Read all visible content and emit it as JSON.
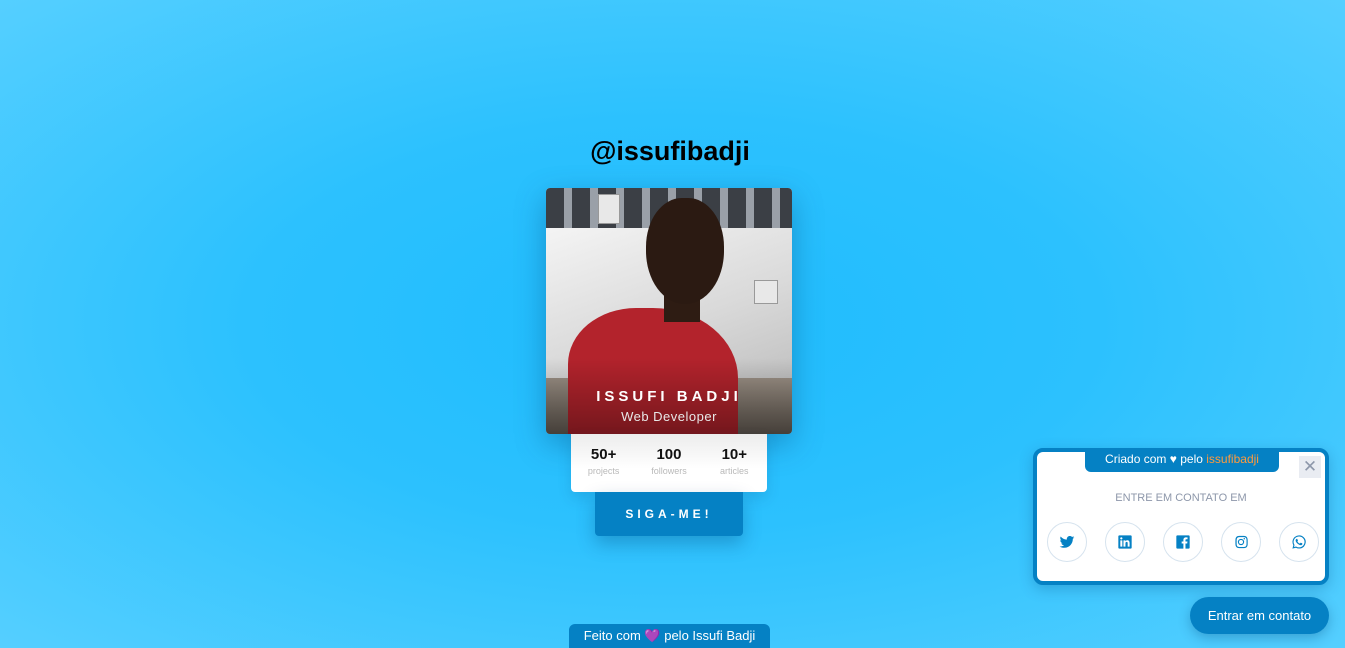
{
  "profile": {
    "handle": "@issufibadji",
    "name": "ISSUFI BADJI",
    "role": "Web Developer",
    "stats": [
      {
        "value": "50+",
        "label": "projects"
      },
      {
        "value": "100",
        "label": "followers"
      },
      {
        "value": "10+",
        "label": "articles"
      }
    ],
    "follow_label": "SIGA-ME!"
  },
  "footer": {
    "prefix": "Feito com",
    "heart": "💜",
    "suffix": "pelo Issufi Badji"
  },
  "contact_widget": {
    "credit_prefix": "Criado com",
    "credit_heart": "♥",
    "credit_middle": "pelo",
    "credit_link": "issufibadji",
    "close_label": "✕",
    "title": "ENTRE EM CONTATO EM",
    "icons": [
      "twitter-icon",
      "linkedin-icon",
      "facebook-icon",
      "instagram-icon",
      "whatsapp-icon"
    ]
  },
  "contact_button_label": "Entrar em contato",
  "colors": {
    "accent": "#0581c4",
    "background": "#2cc1fe",
    "link": "#ff9a3c"
  }
}
